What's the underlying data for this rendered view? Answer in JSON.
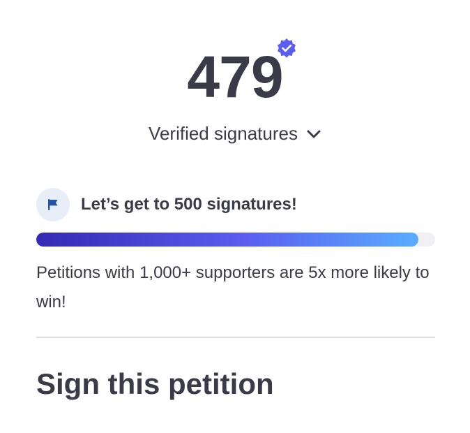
{
  "signatures": {
    "count": "479",
    "label": "Verified signatures",
    "badge_icon": "verified-check-icon",
    "dropdown_icon": "chevron-down-icon"
  },
  "goal": {
    "icon": "flag-icon",
    "text": "Let’s get to 500 signatures!",
    "progress": 0.958
  },
  "tip": "Petitions with 1,000+ supporters are 5x more likely to win!",
  "section": {
    "heading": "Sign this petition"
  },
  "colors": {
    "text": "#3b3a48",
    "badge": "#5b5ef0",
    "flag": "#2455a4",
    "progress_start": "#3429b4",
    "progress_end": "#59adff"
  }
}
